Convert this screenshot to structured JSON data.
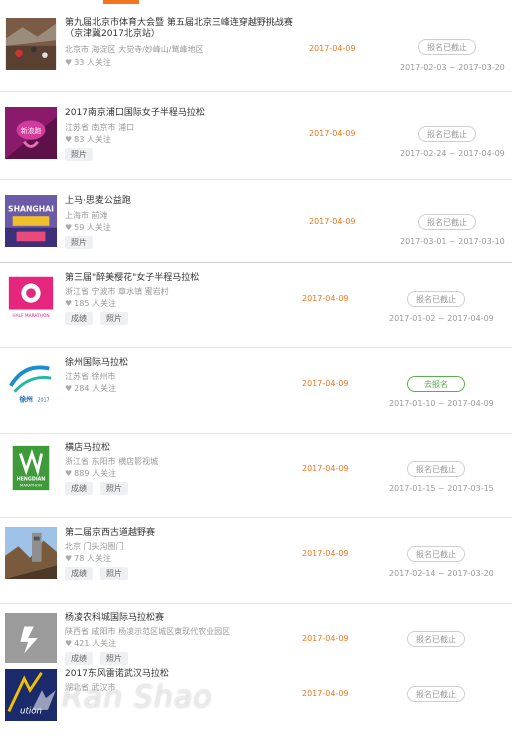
{
  "colors": {
    "accent": "#f2751c",
    "open": "#57b04b"
  },
  "events": [
    {
      "title_lines": [
        "第九届北京市体育大会暨 第五届北京三峰连穿越野挑战赛",
        "（京津冀2017北京站）"
      ],
      "location": "北京市 海淀区 大觉寺/妙峰山/鹫峰地区",
      "follows": "33 人关注",
      "tags": [],
      "date": "2017-04-09",
      "button": "报名已截止",
      "range": "2017-02-03 ~ 2017-03-20"
    },
    {
      "title_lines": [
        "2017南京浦口国际女子半程马拉松"
      ],
      "location": "江苏省 南京市 浦口",
      "follows": "83 人关注",
      "tags": [
        "照片"
      ],
      "date": "2017-04-09",
      "button": "报名已截止",
      "range": "2017-02-24 ~ 2017-04-09"
    },
    {
      "title_lines": [
        "上马·思麦公益跑"
      ],
      "location": "上海市 前滩",
      "follows": "59 人关注",
      "tags": [
        "照片"
      ],
      "date": "2017-04-09",
      "button": "报名已截止",
      "range": "2017-03-01 ~ 2017-03-10"
    },
    {
      "title_lines": [
        "第三届\"醉美樱花\"女子半程马拉松"
      ],
      "location": "浙江省 宁波市 章水镇 蜜岩村",
      "follows": "185 人关注",
      "tags": [
        "成绩",
        "照片"
      ],
      "date": "2017-04-09",
      "button": "报名已截止",
      "range": "2017-01-02 ~ 2017-04-09"
    },
    {
      "title_lines": [
        "徐州国际马拉松"
      ],
      "location": "江苏省 徐州市",
      "follows": "284 人关注",
      "tags": [],
      "date": "2017-04-09",
      "button": "去报名",
      "range": "2017-01-10 ~ 2017-04-09"
    },
    {
      "title_lines": [
        "横店马拉松"
      ],
      "location": "浙江省 东阳市 横店影视城",
      "follows": "889 人关注",
      "tags": [
        "成绩",
        "照片"
      ],
      "date": "2017-04-09",
      "button": "报名已截止",
      "range": "2017-01-15 ~ 2017-03-15"
    },
    {
      "title_lines": [
        "第二届京西古道越野赛"
      ],
      "location": "北京 门头沟圈门",
      "follows": "78 人关注",
      "tags": [
        "成绩",
        "照片"
      ],
      "date": "2017-04-09",
      "button": "报名已截止",
      "range": "2017-02-14 ~ 2017-03-20"
    },
    {
      "title_lines": [
        "杨凌农科城国际马拉松赛"
      ],
      "location": "陕西省 咸阳市 杨凌示范区城区東现代农业园区",
      "follows": "421 人关注",
      "tags": [
        "成绩",
        "照片"
      ],
      "date": "2017-04-09",
      "button": "报名已截止",
      "range": ""
    },
    {
      "title_lines": [
        "2017东风雷诺武汉马拉松"
      ],
      "location": "湖北省 武汉市",
      "follows": "",
      "tags": [],
      "date": "2017-04-09",
      "button": "报名已截止",
      "range": ""
    }
  ],
  "thumb_text": {
    "shanghai": "SHANGHAI",
    "sakura_sub": "HALF MARATHON",
    "xuzhou": "徐州",
    "xuzhou_year": "2017",
    "hengdian": "HENGDIAN",
    "hengdian_sub": "MARATHON",
    "wuhan": "ution"
  },
  "watermark": "Ran Shao"
}
